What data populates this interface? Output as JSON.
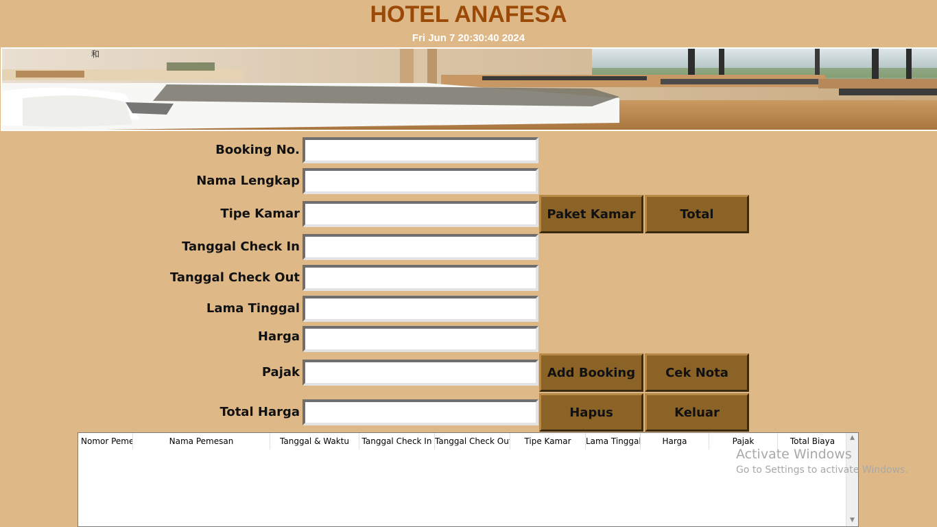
{
  "header": {
    "title": "HOTEL ANAFESA",
    "datetime": "Fri Jun  7 20:30:40 2024"
  },
  "form": {
    "booking_no": {
      "label": "Booking No.",
      "value": ""
    },
    "nama_lengkap": {
      "label": "Nama Lengkap",
      "value": ""
    },
    "tipe_kamar": {
      "label": "Tipe Kamar",
      "value": ""
    },
    "tanggal_check_in": {
      "label": "Tanggal Check In",
      "value": ""
    },
    "tanggal_check_out": {
      "label": "Tanggal Check Out",
      "value": ""
    },
    "lama_tinggal": {
      "label": "Lama Tinggal",
      "value": ""
    },
    "harga": {
      "label": "Harga",
      "value": ""
    },
    "pajak": {
      "label": "Pajak",
      "value": ""
    },
    "total_harga": {
      "label": "Total Harga",
      "value": ""
    }
  },
  "buttons": {
    "paket_kamar": "Paket Kamar",
    "total": "Total",
    "add_booking": "Add Booking",
    "cek_nota": "Cek Nota",
    "hapus": "Hapus",
    "keluar": "Keluar"
  },
  "table": {
    "columns": [
      "Nomor Peme",
      "Nama Pemesan",
      "Tanggal & Waktu",
      "Tanggal Check In",
      "Tanggal Check Out",
      "Tipe Kamar",
      "Lama Tinggal",
      "Harga",
      "Pajak",
      "Total Biaya"
    ],
    "rows": []
  },
  "watermark": {
    "line1": "Activate Windows",
    "line2": "Go to Settings to activate Windows."
  },
  "colors": {
    "background": "#deb887",
    "title": "#9a4a06",
    "button": "#8b6327"
  }
}
